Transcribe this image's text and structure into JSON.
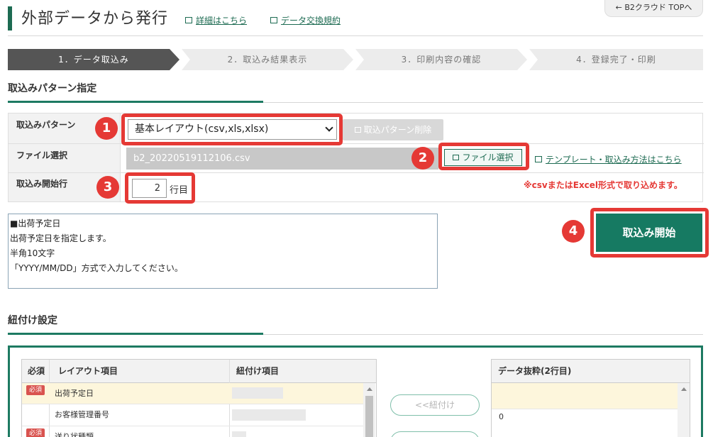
{
  "header": {
    "title": "外部データから発行",
    "link_detail": "詳細はこちら",
    "link_terms": "データ交換規約",
    "top_button": "B2クラウド TOPへ"
  },
  "steps": [
    {
      "label": "1．データ取込み",
      "active": true
    },
    {
      "label": "2．取込み結果表示",
      "active": false
    },
    {
      "label": "3．印刷内容の確認",
      "active": false
    },
    {
      "label": "4．登録完了・印刷",
      "active": false
    }
  ],
  "pattern_section": {
    "title": "取込みパターン指定",
    "labels": {
      "pattern": "取込みパターン",
      "file": "ファイル選択",
      "start_row": "取込み開始行"
    },
    "pattern_value": "基本レイアウト(csv,xls,xlsx)",
    "delete_button": "取込パターン削除",
    "file_value": "b2_20220519112106.csv",
    "file_button": "ファイル選択",
    "template_link": "テンプレート・取込み方法はこちら",
    "start_row_value": "2",
    "start_row_unit": "行目",
    "warning": "※csvまたはExcel形式で取り込めます。"
  },
  "callouts": [
    "1",
    "2",
    "3",
    "4"
  ],
  "description": [
    "■出荷予定日",
    "出荷予定日を指定します。",
    "半角10文字",
    "「YYYY/MM/DD」方式で入力してください。"
  ],
  "start_button": "取込み開始",
  "mapping_section": {
    "title": "紐付け設定",
    "headers": {
      "required": "必須",
      "layout_item": "レイアウト項目",
      "mapped_item": "紐付け項目",
      "data_extract": "データ抜粋(2行目)"
    },
    "rows": [
      {
        "required": "必須",
        "item": "出荷予定日",
        "extract": ""
      },
      {
        "required": "",
        "item": "お客様管理番号",
        "extract": "0"
      },
      {
        "required": "必須",
        "item": "送り状種類",
        "extract": ""
      }
    ],
    "link_button": "<<紐付け"
  },
  "colors": {
    "brand_green": "#1d6b52",
    "callout_red": "#e53935",
    "highlight_row": "#fdf6dc"
  }
}
